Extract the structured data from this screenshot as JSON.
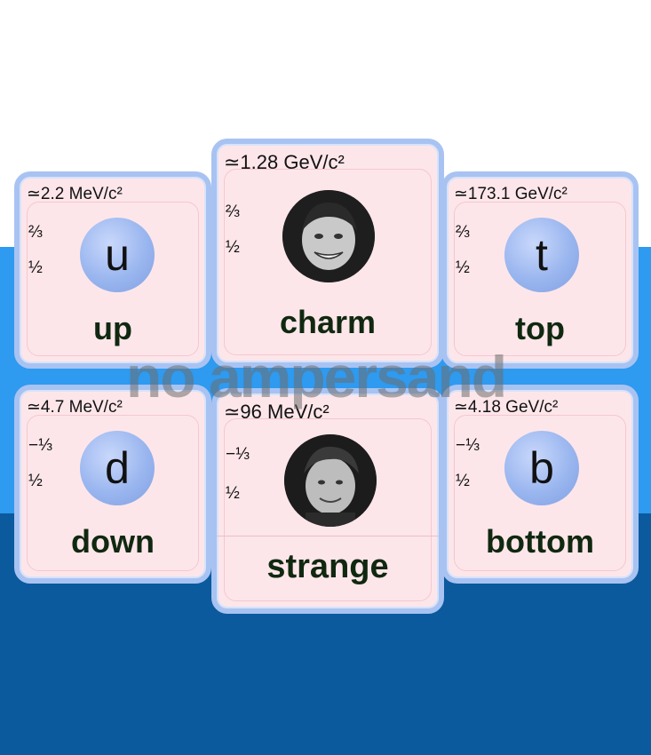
{
  "quarks": {
    "up": {
      "mass": "≃2.2 MeV/c²",
      "charge": "⅔",
      "spin": "½",
      "symbol": "u",
      "name": "up"
    },
    "charm": {
      "mass": "≃1.28 GeV/c²",
      "charge": "⅔",
      "spin": "½",
      "name": "charm"
    },
    "top": {
      "mass": "≃173.1 GeV/c²",
      "charge": "⅔",
      "spin": "½",
      "symbol": "t",
      "name": "top"
    },
    "down": {
      "mass": "≃4.7 MeV/c²",
      "charge": "−⅓",
      "spin": "½",
      "symbol": "d",
      "name": "down"
    },
    "strange": {
      "mass": "≃96 MeV/c²",
      "charge": "−⅓",
      "spin": "½",
      "name": "strange"
    },
    "bottom": {
      "mass": "≃4.18 GeV/c²",
      "charge": "−⅓",
      "spin": "½",
      "symbol": "b",
      "name": "bottom"
    }
  },
  "watermark": "no ampersand",
  "colors": {
    "card_fill": "#fde6ea",
    "card_border": "#a8c3f2",
    "symbol_blue": "#9ab6ef",
    "band_light": "#2e9af0",
    "band_dark": "#0b5a9e"
  }
}
